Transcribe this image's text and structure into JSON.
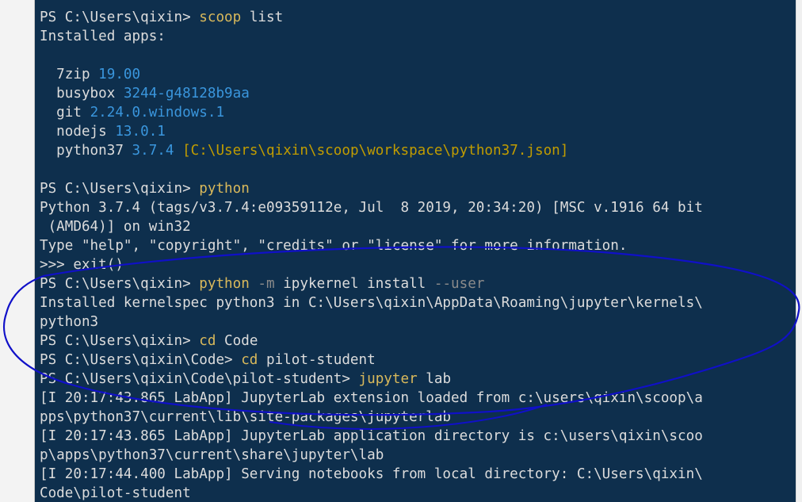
{
  "colors": {
    "terminal_bg": "#0e2f4d",
    "default_text": "#dcdcdc",
    "command": "#d9b95b",
    "version": "#3a96dd",
    "path_highlight": "#c19c00",
    "parameter": "#8a8a8a",
    "annotation_stroke": "#1010c8"
  },
  "terminal": {
    "lines": [
      [
        {
          "t": "PS C:\\Users\\qixin> ",
          "c": "default"
        },
        {
          "t": "scoop",
          "c": "cmd"
        },
        {
          "t": " list",
          "c": "default"
        }
      ],
      [
        {
          "t": "Installed apps:",
          "c": "default"
        }
      ],
      [
        {
          "t": "",
          "c": "default"
        }
      ],
      [
        {
          "t": "  7zip ",
          "c": "default"
        },
        {
          "t": "19.00",
          "c": "ver"
        }
      ],
      [
        {
          "t": "  busybox ",
          "c": "default"
        },
        {
          "t": "3244-g48128b9aa",
          "c": "ver"
        }
      ],
      [
        {
          "t": "  git ",
          "c": "default"
        },
        {
          "t": "2.24.0.windows.1",
          "c": "ver"
        }
      ],
      [
        {
          "t": "  nodejs ",
          "c": "default"
        },
        {
          "t": "13.0.1",
          "c": "ver"
        }
      ],
      [
        {
          "t": "  python37 ",
          "c": "default"
        },
        {
          "t": "3.7.4",
          "c": "ver"
        },
        {
          "t": " [C:\\Users\\qixin\\scoop\\workspace\\python37.json]",
          "c": "path"
        }
      ],
      [
        {
          "t": "",
          "c": "default"
        }
      ],
      [
        {
          "t": "PS C:\\Users\\qixin> ",
          "c": "default"
        },
        {
          "t": "python",
          "c": "cmd"
        }
      ],
      [
        {
          "t": "Python 3.7.4 (tags/v3.7.4:e09359112e, Jul  8 2019, 20:34:20) [MSC v.1916 64 bit",
          "c": "default"
        }
      ],
      [
        {
          "t": " (AMD64)] on win32",
          "c": "default"
        }
      ],
      [
        {
          "t": "Type \"help\", \"copyright\", \"credits\" or \"license\" for more information.",
          "c": "default"
        }
      ],
      [
        {
          "t": ">>> exit()",
          "c": "default"
        }
      ],
      [
        {
          "t": "PS C:\\Users\\qixin> ",
          "c": "default"
        },
        {
          "t": "python",
          "c": "cmd"
        },
        {
          "t": " -m",
          "c": "param"
        },
        {
          "t": " ipykernel install ",
          "c": "default"
        },
        {
          "t": "--user",
          "c": "param"
        }
      ],
      [
        {
          "t": "Installed kernelspec python3 in C:\\Users\\qixin\\AppData\\Roaming\\jupyter\\kernels\\",
          "c": "default"
        }
      ],
      [
        {
          "t": "python3",
          "c": "default"
        }
      ],
      [
        {
          "t": "PS C:\\Users\\qixin> ",
          "c": "default"
        },
        {
          "t": "cd",
          "c": "cmd"
        },
        {
          "t": " Code",
          "c": "default"
        }
      ],
      [
        {
          "t": "PS C:\\Users\\qixin\\Code> ",
          "c": "default"
        },
        {
          "t": "cd",
          "c": "cmd"
        },
        {
          "t": " pilot-student",
          "c": "default"
        }
      ],
      [
        {
          "t": "PS C:\\Users\\qixin\\Code\\pilot-student> ",
          "c": "default"
        },
        {
          "t": "jupyter",
          "c": "cmd"
        },
        {
          "t": " lab",
          "c": "default"
        }
      ],
      [
        {
          "t": "[I 20:17:43.865 LabApp] JupyterLab extension loaded from c:\\users\\qixin\\scoop\\a",
          "c": "default"
        }
      ],
      [
        {
          "t": "pps\\python37\\current\\lib\\site-packages\\jupyterlab",
          "c": "default"
        }
      ],
      [
        {
          "t": "[I 20:17:43.865 LabApp] JupyterLab application directory is c:\\users\\qixin\\scoo",
          "c": "default"
        }
      ],
      [
        {
          "t": "p\\apps\\python37\\current\\share\\jupyter\\lab",
          "c": "default"
        }
      ],
      [
        {
          "t": "[I 20:17:44.400 LabApp] Serving notebooks from local directory: C:\\Users\\qixin\\",
          "c": "default"
        }
      ],
      [
        {
          "t": "Code\\pilot-student",
          "c": "default"
        }
      ]
    ]
  }
}
